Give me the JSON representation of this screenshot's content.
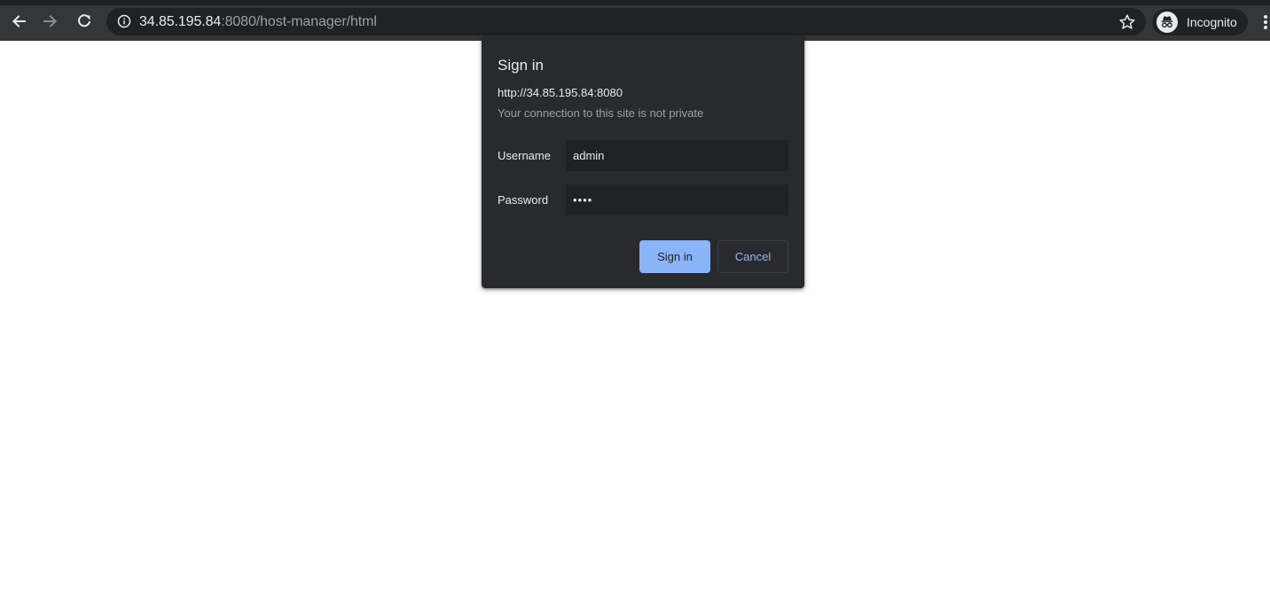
{
  "browser": {
    "url_host": "34.85.195.84",
    "url_rest": ":8080/host-manager/html",
    "profile_label": "Incognito",
    "icons": {
      "back": "arrow-left-icon",
      "forward": "arrow-right-icon",
      "reload": "reload-icon",
      "info": "info-icon",
      "star": "star-icon",
      "incognito": "incognito-icon",
      "menu": "kebab-menu-icon"
    }
  },
  "auth_dialog": {
    "title": "Sign in",
    "origin": "http://34.85.195.84:8080",
    "warning": "Your connection to this site is not private",
    "username_label": "Username",
    "username_value": "admin",
    "password_label": "Password",
    "password_value": "••••",
    "signin_label": "Sign in",
    "cancel_label": "Cancel"
  },
  "colors": {
    "toolbar": "#35363a",
    "omnibox": "#202124",
    "dialog": "#292a2d",
    "accent": "#8ab4f8",
    "text_primary": "#e8eaed",
    "text_secondary": "#9aa0a6"
  }
}
